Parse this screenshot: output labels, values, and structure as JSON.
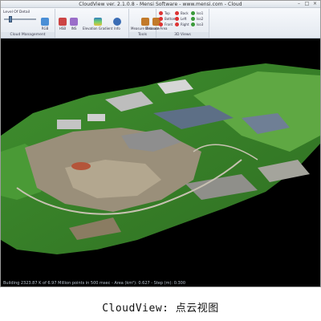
{
  "window": {
    "title": "CloudView ver. 2.1.0.8 - Mensi Software - www.mensi.com - Cloud"
  },
  "ribbon": {
    "groups": {
      "cloud_management": {
        "label": "Cloud Management"
      },
      "tools": {
        "label": "Tools"
      },
      "views": {
        "label": "3D Views"
      }
    },
    "lod_label": "Level Of Detail",
    "buttons": {
      "rgb": "RGB",
      "hsb": "HSB",
      "ins": "INS",
      "elevation_gradient": "Elevation Gradient",
      "info": "Info",
      "measure_distance": "Measure Distance",
      "measure_area": "Measure Area"
    },
    "views": {
      "top": "Top",
      "bottom": "Bottom",
      "front": "Front",
      "back": "Back",
      "left": "Left",
      "right": "Right",
      "iso1": "Iso1",
      "iso2": "Iso2",
      "iso3": "Iso3"
    },
    "colors": {
      "rgb": "#4a8fd6",
      "hsb": "#c44",
      "ins": "#9a6dc9",
      "elevation": "#2f7fc1",
      "info": "#3b6db5",
      "measure": "#c27a2a",
      "view_dot": "#d33",
      "iso_dot": "#3a9a3a"
    }
  },
  "status": {
    "text": "Building 2323.87 K of 6.97 Million points in 500 msec - Area (km²): 0.627 - Step (m): 0.300"
  },
  "caption": "CloudView: 点云视图"
}
